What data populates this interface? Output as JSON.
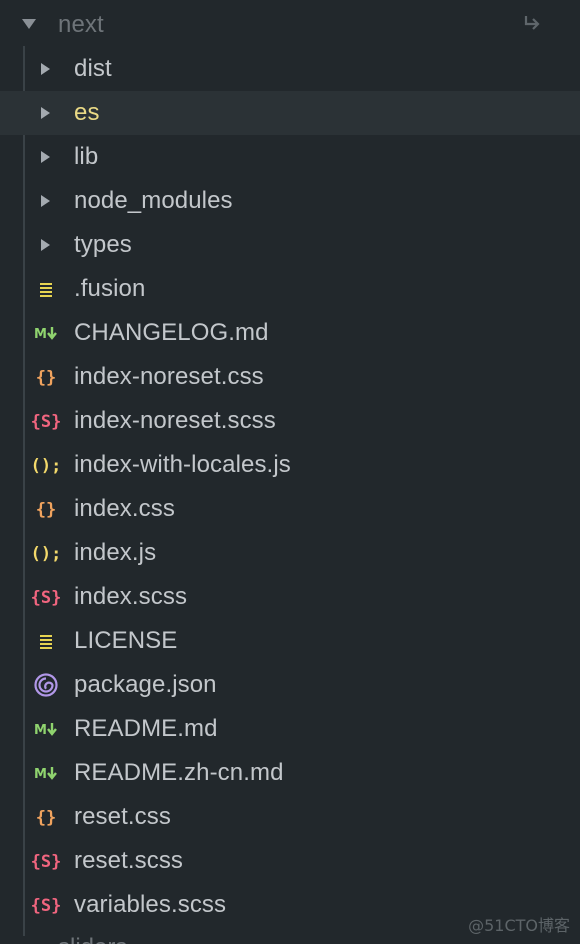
{
  "explorer": {
    "root_folder": "next",
    "items": [
      {
        "label": "dist",
        "type": "folder",
        "icon": "caret-right-icon"
      },
      {
        "label": "es",
        "type": "folder",
        "icon": "caret-right-icon",
        "selected": true
      },
      {
        "label": "lib",
        "type": "folder",
        "icon": "caret-right-icon"
      },
      {
        "label": "node_modules",
        "type": "folder",
        "icon": "caret-right-icon"
      },
      {
        "label": "types",
        "type": "folder",
        "icon": "caret-right-icon"
      },
      {
        "label": ".fusion",
        "type": "file",
        "icon": "text-file-icon"
      },
      {
        "label": "CHANGELOG.md",
        "type": "file",
        "icon": "markdown-icon"
      },
      {
        "label": "index-noreset.css",
        "type": "file",
        "icon": "css-icon"
      },
      {
        "label": "index-noreset.scss",
        "type": "file",
        "icon": "scss-icon"
      },
      {
        "label": "index-with-locales.js",
        "type": "file",
        "icon": "js-icon"
      },
      {
        "label": "index.css",
        "type": "file",
        "icon": "css-icon"
      },
      {
        "label": "index.js",
        "type": "file",
        "icon": "js-icon"
      },
      {
        "label": "index.scss",
        "type": "file",
        "icon": "scss-icon"
      },
      {
        "label": "LICENSE",
        "type": "file",
        "icon": "text-file-icon"
      },
      {
        "label": "package.json",
        "type": "file",
        "icon": "package-json-icon"
      },
      {
        "label": "README.md",
        "type": "file",
        "icon": "markdown-icon"
      },
      {
        "label": "README.zh-cn.md",
        "type": "file",
        "icon": "markdown-icon"
      },
      {
        "label": "reset.css",
        "type": "file",
        "icon": "css-icon"
      },
      {
        "label": "reset.scss",
        "type": "file",
        "icon": "scss-icon"
      },
      {
        "label": "variables.scss",
        "type": "file",
        "icon": "scss-icon"
      }
    ],
    "next_folder_partial": "sliders"
  },
  "colors": {
    "background": "#22282c",
    "selected_row": "#2b3236",
    "selected_text": "#e9d985",
    "text": "#c3c7cb",
    "css": "#f0a35e",
    "scss": "#f0657f",
    "js": "#f3d96b",
    "markdown": "#8fd36e",
    "text_file": "#e7d451",
    "package_json": "#b197e8"
  },
  "watermark": "@51CTO博客"
}
